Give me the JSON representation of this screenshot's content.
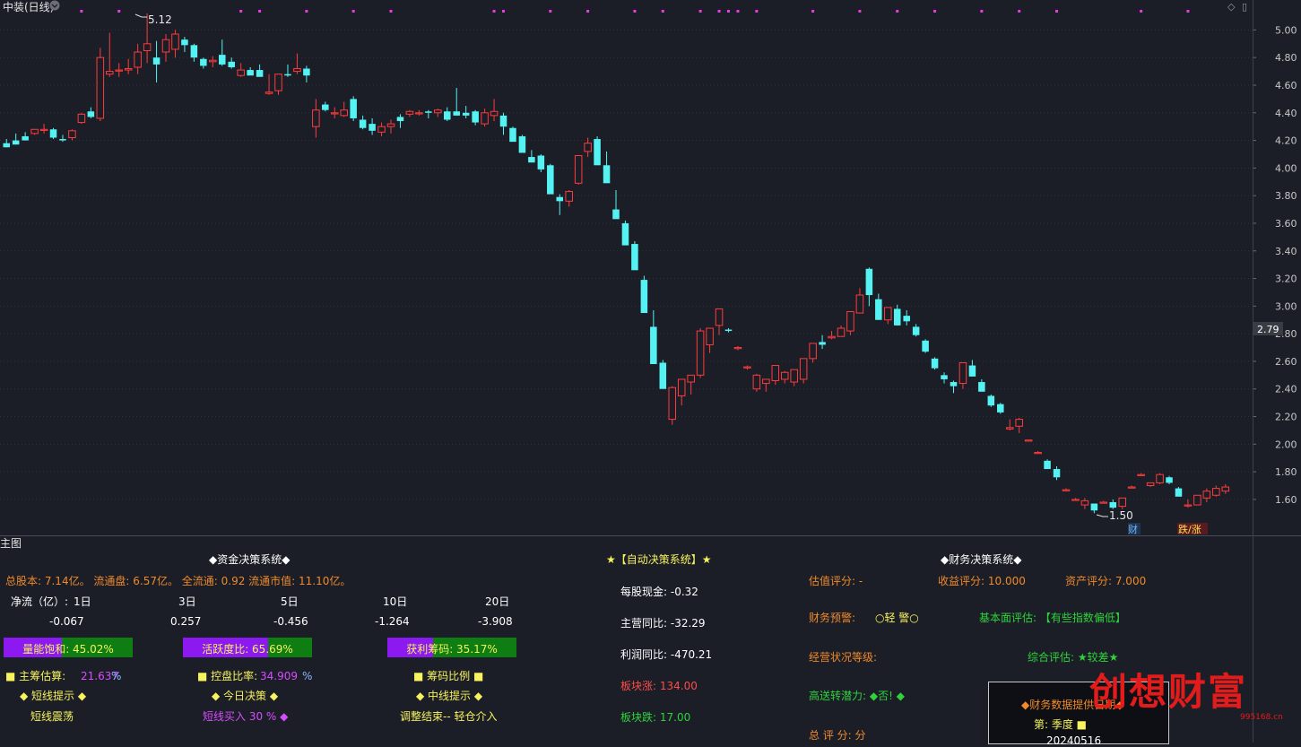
{
  "title": "中装(日线)",
  "window_buttons": [
    "◇",
    "▯"
  ],
  "chart_data": {
    "type": "candlestick",
    "ylim": [
      1.45,
      5.1
    ],
    "yticks": [
      "5.00",
      "4.80",
      "4.60",
      "4.40",
      "4.20",
      "4.00",
      "3.80",
      "3.60",
      "3.40",
      "3.20",
      "3.00",
      "2.80",
      "2.60",
      "2.40",
      "2.20",
      "2.00",
      "1.80",
      "1.60"
    ],
    "current_price": "2.79",
    "max_label": "5.12",
    "min_label": "1.50",
    "candles": [
      [
        4.18,
        4.21,
        4.15,
        4.15
      ],
      [
        4.2,
        4.25,
        4.17,
        4.17
      ],
      [
        4.23,
        4.26,
        4.2,
        4.2
      ],
      [
        4.25,
        4.28,
        4.24,
        4.28
      ],
      [
        4.28,
        4.32,
        4.25,
        4.28
      ],
      [
        4.28,
        4.29,
        4.21,
        4.22
      ],
      [
        4.21,
        4.24,
        4.19,
        4.2
      ],
      [
        4.22,
        4.28,
        4.2,
        4.27
      ],
      [
        4.33,
        4.4,
        4.32,
        4.39
      ],
      [
        4.41,
        4.44,
        4.36,
        4.37
      ],
      [
        4.36,
        4.87,
        4.34,
        4.8
      ],
      [
        4.68,
        4.98,
        4.66,
        4.7
      ],
      [
        4.71,
        4.76,
        4.66,
        4.71
      ],
      [
        4.71,
        4.79,
        4.68,
        4.72
      ],
      [
        4.73,
        4.9,
        4.68,
        4.84
      ],
      [
        4.85,
        5.12,
        4.76,
        4.9
      ],
      [
        4.8,
        4.92,
        4.62,
        4.75
      ],
      [
        4.84,
        4.97,
        4.77,
        4.93
      ],
      [
        4.86,
        5.0,
        4.8,
        4.97
      ],
      [
        4.93,
        4.95,
        4.84,
        4.89
      ],
      [
        4.89,
        4.9,
        4.77,
        4.8
      ],
      [
        4.79,
        4.8,
        4.72,
        4.74
      ],
      [
        4.77,
        4.81,
        4.73,
        4.78
      ],
      [
        4.82,
        4.93,
        4.74,
        4.75
      ],
      [
        4.77,
        4.8,
        4.72,
        4.73
      ],
      [
        4.67,
        4.76,
        4.66,
        4.71
      ],
      [
        4.71,
        4.73,
        4.69,
        4.67
      ],
      [
        4.71,
        4.75,
        4.68,
        4.66
      ],
      [
        4.54,
        4.68,
        4.53,
        4.55
      ],
      [
        4.56,
        4.68,
        4.53,
        4.68
      ],
      [
        4.68,
        4.75,
        4.66,
        4.67
      ],
      [
        4.7,
        4.83,
        4.68,
        4.72
      ],
      [
        4.72,
        4.74,
        4.62,
        4.67
      ],
      [
        4.3,
        4.5,
        4.22,
        4.42
      ],
      [
        4.46,
        4.48,
        4.41,
        4.42
      ],
      [
        4.4,
        4.44,
        4.36,
        4.4
      ],
      [
        4.38,
        4.48,
        4.37,
        4.42
      ],
      [
        4.5,
        4.52,
        4.34,
        4.36
      ],
      [
        4.35,
        4.38,
        4.28,
        4.29
      ],
      [
        4.32,
        4.36,
        4.24,
        4.27
      ],
      [
        4.26,
        4.33,
        4.23,
        4.3
      ],
      [
        4.3,
        4.35,
        4.25,
        4.32
      ],
      [
        4.37,
        4.39,
        4.29,
        4.34
      ],
      [
        4.39,
        4.42,
        4.37,
        4.41
      ],
      [
        4.4,
        4.42,
        4.38,
        4.4
      ],
      [
        4.41,
        4.42,
        4.36,
        4.4
      ],
      [
        4.4,
        4.43,
        4.37,
        4.42
      ],
      [
        4.41,
        4.44,
        4.34,
        4.35
      ],
      [
        4.41,
        4.58,
        4.38,
        4.38
      ],
      [
        4.4,
        4.45,
        4.36,
        4.38
      ],
      [
        4.41,
        4.42,
        4.31,
        4.33
      ],
      [
        4.32,
        4.43,
        4.3,
        4.4
      ],
      [
        4.38,
        4.5,
        4.34,
        4.41
      ],
      [
        4.38,
        4.4,
        4.24,
        4.3
      ],
      [
        4.29,
        4.3,
        4.2,
        4.19
      ],
      [
        4.23,
        4.24,
        4.12,
        4.11
      ],
      [
        4.08,
        4.13,
        4.04,
        4.04
      ],
      [
        4.09,
        4.1,
        3.97,
        3.99
      ],
      [
        4.02,
        4.03,
        3.86,
        3.81
      ],
      [
        3.79,
        3.81,
        3.66,
        3.76
      ],
      [
        3.76,
        3.84,
        3.72,
        3.83
      ],
      [
        3.89,
        4.01,
        3.88,
        4.09
      ],
      [
        4.12,
        4.22,
        4.08,
        4.18
      ],
      [
        4.21,
        4.23,
        4.08,
        4.02
      ],
      [
        4.02,
        4.12,
        3.97,
        3.89
      ],
      [
        3.7,
        3.84,
        3.67,
        3.63
      ],
      [
        3.6,
        3.62,
        3.47,
        3.44
      ],
      [
        3.45,
        3.47,
        3.3,
        3.26
      ],
      [
        3.19,
        3.22,
        3.02,
        2.95
      ],
      [
        2.85,
        2.97,
        2.58,
        2.58
      ],
      [
        2.59,
        2.61,
        2.41,
        2.4
      ],
      [
        2.18,
        2.42,
        2.14,
        2.41
      ],
      [
        2.35,
        2.46,
        2.28,
        2.47
      ],
      [
        2.45,
        2.5,
        2.36,
        2.5
      ],
      [
        2.5,
        2.84,
        2.48,
        2.82
      ],
      [
        2.72,
        2.84,
        2.66,
        2.84
      ],
      [
        2.86,
        2.98,
        2.79,
        2.98
      ],
      [
        2.83,
        2.84,
        2.81,
        2.82
      ],
      [
        2.7,
        2.71,
        2.68,
        2.7
      ],
      [
        2.56,
        2.57,
        2.54,
        2.56
      ],
      [
        2.4,
        2.51,
        2.38,
        2.5
      ],
      [
        2.44,
        2.47,
        2.38,
        2.47
      ],
      [
        2.46,
        2.55,
        2.43,
        2.57
      ],
      [
        2.47,
        2.53,
        2.44,
        2.52
      ],
      [
        2.45,
        2.53,
        2.42,
        2.54
      ],
      [
        2.47,
        2.61,
        2.44,
        2.62
      ],
      [
        2.62,
        2.72,
        2.59,
        2.73
      ],
      [
        2.74,
        2.79,
        2.69,
        2.72
      ],
      [
        2.77,
        2.82,
        2.76,
        2.78
      ],
      [
        2.78,
        2.86,
        2.78,
        2.84
      ],
      [
        2.82,
        2.93,
        2.79,
        2.96
      ],
      [
        2.95,
        3.13,
        2.95,
        3.08
      ],
      [
        3.27,
        3.28,
        3.0,
        3.08
      ],
      [
        3.05,
        3.09,
        2.9,
        2.9
      ],
      [
        2.9,
        2.99,
        2.87,
        2.99
      ],
      [
        2.98,
        3.01,
        2.86,
        2.86
      ],
      [
        2.93,
        2.97,
        2.86,
        2.89
      ],
      [
        2.85,
        2.87,
        2.78,
        2.79
      ],
      [
        2.75,
        2.76,
        2.66,
        2.67
      ],
      [
        2.62,
        2.63,
        2.54,
        2.55
      ],
      [
        2.5,
        2.52,
        2.44,
        2.47
      ],
      [
        2.45,
        2.46,
        2.37,
        2.42
      ],
      [
        2.44,
        2.53,
        2.4,
        2.59
      ],
      [
        2.57,
        2.61,
        2.49,
        2.49
      ],
      [
        2.45,
        2.47,
        2.39,
        2.38
      ],
      [
        2.35,
        2.36,
        2.27,
        2.28
      ],
      [
        2.29,
        2.3,
        2.22,
        2.23
      ],
      [
        2.11,
        2.18,
        2.1,
        2.12
      ],
      [
        2.13,
        2.19,
        2.08,
        2.18
      ],
      [
        2.03,
        2.03,
        2.02,
        2.03
      ],
      [
        1.94,
        1.95,
        1.93,
        1.94
      ],
      [
        1.88,
        1.89,
        1.85,
        1.82
      ],
      [
        1.82,
        1.84,
        1.74,
        1.76
      ],
      [
        1.67,
        1.68,
        1.66,
        1.67
      ],
      [
        1.6,
        1.61,
        1.59,
        1.6
      ],
      [
        1.56,
        1.61,
        1.53,
        1.59
      ],
      [
        1.57,
        1.57,
        1.5,
        1.52
      ],
      [
        1.58,
        1.59,
        1.57,
        1.58
      ],
      [
        1.58,
        1.6,
        1.53,
        1.54
      ],
      [
        1.55,
        1.6,
        1.53,
        1.61
      ],
      [
        1.69,
        1.7,
        1.68,
        1.69
      ],
      [
        1.78,
        1.79,
        1.77,
        1.78
      ],
      [
        1.7,
        1.71,
        1.69,
        1.72
      ],
      [
        1.72,
        1.79,
        1.71,
        1.78
      ],
      [
        1.76,
        1.77,
        1.71,
        1.72
      ],
      [
        1.68,
        1.69,
        1.63,
        1.62
      ],
      [
        1.56,
        1.6,
        1.54,
        1.56
      ],
      [
        1.56,
        1.63,
        1.56,
        1.63
      ],
      [
        1.61,
        1.68,
        1.58,
        1.66
      ],
      [
        1.63,
        1.7,
        1.62,
        1.68
      ],
      [
        1.66,
        1.71,
        1.64,
        1.69
      ]
    ],
    "markers": [
      "财",
      "跌/涨"
    ]
  },
  "panel": {
    "title": "主图",
    "zijin": {
      "title": "◆资金决策系统◆",
      "info": "总股本: 7.14亿。 流通盘: 6.57亿。 全流通: 0.92 流通市值: 11.10亿。",
      "jingliu_label": "净流（亿）:",
      "days": [
        "1日",
        "3日",
        "5日",
        "10日",
        "20日"
      ],
      "values": [
        "-0.067",
        "0.257",
        "-0.456",
        "-1.264",
        "-3.908"
      ],
      "bar1_label": "量能饱和:  45.02%",
      "bar1_value": 0.4502,
      "bar2_label": "活跃度比:  65.69%",
      "bar2_value": 0.6569,
      "bar3_label": "获利筹码:  35.17%",
      "bar3_value": 0.3517,
      "zhuchou_label": "■ 主筹估算:",
      "zhuchou_value": "21.637",
      "zhuchou_unit": "%",
      "kongpan_label": "■ 控盘比率:",
      "kongpan_value": "34.909",
      "kongpan_unit": "%",
      "choumabili": "■ 筹码比例 ■",
      "short_hint_title": "◆ 短线提示 ◆",
      "today_title": "◆ 今日决策 ◆",
      "mid_hint_title": "◆ 中线提示 ◆",
      "short_hint": "短线震荡",
      "today": "短线买入 30 % ◆",
      "mid_hint": "调整结束-- 轻仓介入"
    },
    "auto": {
      "title": "★【自动决策系统】★",
      "mgxj": "每股现金: -0.32",
      "zytb": "主营同比: -32.29",
      "lrtb": "利润同比: -470.21",
      "bkz": "板块涨: 134.00",
      "bkd": "板块跌: 17.00"
    },
    "caiwu": {
      "title": "◆财务决策系统◆",
      "guzhi": "估值评分: -",
      "shouyi": "收益评分: 10.000",
      "zichan": "资产评分: 7.000",
      "yujing_label": "财务预警:",
      "yujing_value": "○轻 警○",
      "jiben": "基本面评估: 【有些指数偏低】",
      "jingying": "经营状况等级:",
      "zonghe": "综合评估: ★较差★",
      "gaosong": "高送转潜力: ◆否! ◆",
      "zong": "总 评 分:  分",
      "box_title": "◆财务数据提供日期◆",
      "box_q": "第: 季度 ■",
      "box_date": "20240516"
    },
    "watermark": "创想财富",
    "watermark_url": "995168.cn"
  }
}
